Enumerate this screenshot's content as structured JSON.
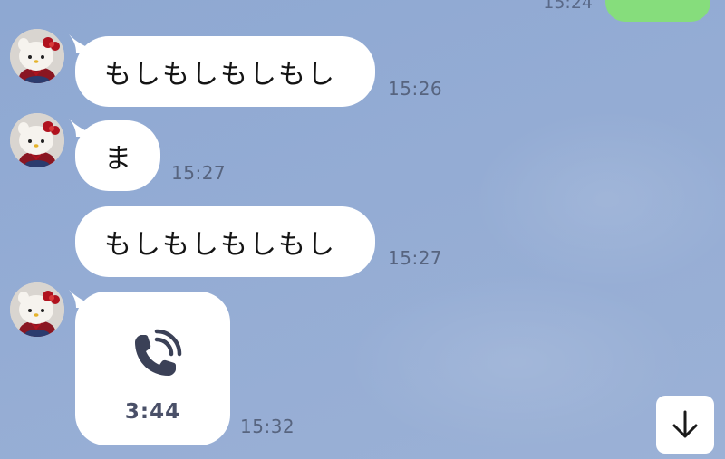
{
  "outgoing_partial": {
    "time": "15:24"
  },
  "messages": [
    {
      "text": "もしもしもしもし",
      "time": "15:26"
    },
    {
      "text": "ま",
      "time": "15:27"
    },
    {
      "text": "もしもしもしもし",
      "time": "15:27"
    }
  ],
  "call": {
    "duration": "3:44",
    "time": "15:32",
    "icon": "phone-call-icon"
  },
  "scroll_button": {
    "icon": "arrow-down-icon"
  },
  "colors": {
    "background": "#94acd4",
    "outgoing_bubble": "#86dd7c",
    "incoming_bubble": "#ffffff",
    "time_text": "#57647f",
    "call_icon": "#3b4157"
  }
}
